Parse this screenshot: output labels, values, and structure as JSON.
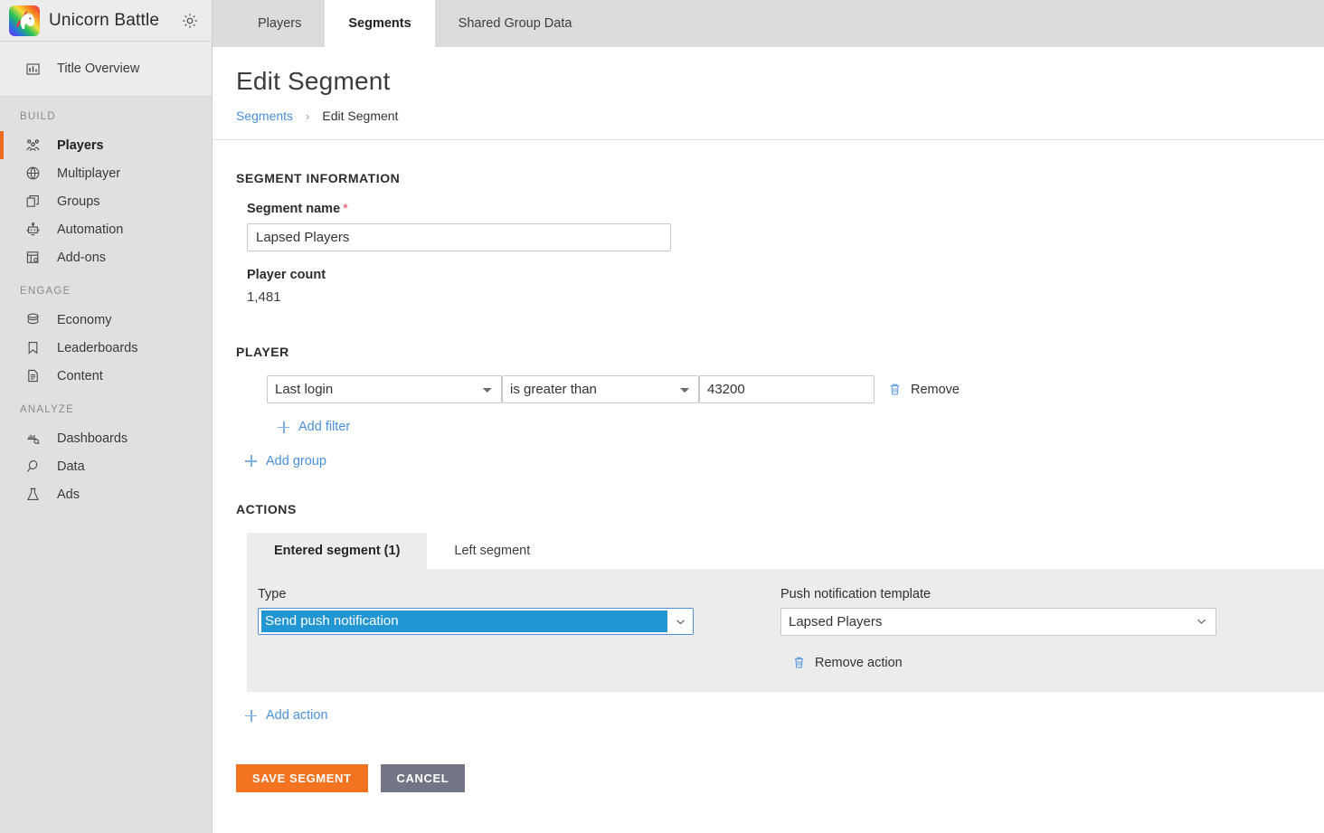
{
  "sidebar": {
    "brand": {
      "title": "Unicorn Battle",
      "logo_icon": "unicorn-logo",
      "settings_icon": "gear-icon"
    },
    "overview": {
      "label": "Title Overview",
      "icon": "bar-chart-icon"
    },
    "groups": [
      {
        "heading": "BUILD",
        "items": [
          {
            "label": "Players",
            "icon": "players-icon",
            "active": true
          },
          {
            "label": "Multiplayer",
            "icon": "globe-icon",
            "active": false
          },
          {
            "label": "Groups",
            "icon": "layers-icon",
            "active": false
          },
          {
            "label": "Automation",
            "icon": "robot-icon",
            "active": false
          },
          {
            "label": "Add-ons",
            "icon": "addons-icon",
            "active": false
          }
        ]
      },
      {
        "heading": "ENGAGE",
        "items": [
          {
            "label": "Economy",
            "icon": "coins-icon",
            "active": false
          },
          {
            "label": "Leaderboards",
            "icon": "bookmark-icon",
            "active": false
          },
          {
            "label": "Content",
            "icon": "document-icon",
            "active": false
          }
        ]
      },
      {
        "heading": "ANALYZE",
        "items": [
          {
            "label": "Dashboards",
            "icon": "dashboard-icon",
            "active": false
          },
          {
            "label": "Data",
            "icon": "data-icon",
            "active": false
          },
          {
            "label": "Ads",
            "icon": "flask-icon",
            "active": false
          }
        ]
      }
    ]
  },
  "tabs": [
    {
      "label": "Players",
      "active": false
    },
    {
      "label": "Segments",
      "active": true
    },
    {
      "label": "Shared Group Data",
      "active": false
    }
  ],
  "page": {
    "title": "Edit Segment",
    "breadcrumb": {
      "link": "Segments",
      "separator": "›",
      "current": "Edit Segment"
    }
  },
  "segment_information": {
    "heading": "SEGMENT INFORMATION",
    "name_label": "Segment name",
    "required_marker": "*",
    "name_value": "Lapsed Players",
    "name_placeholder": "",
    "player_count_label": "Player count",
    "player_count_value": "1,481"
  },
  "player_section": {
    "heading": "PLAYER",
    "filters": [
      {
        "property": "Last login",
        "operator": "is greater than",
        "value": "43200",
        "remove_label": "Remove",
        "remove_icon": "trash-icon"
      }
    ],
    "add_filter_label": "Add filter",
    "add_group_label": "Add group"
  },
  "actions_section": {
    "heading": "ACTIONS",
    "tabs": [
      {
        "label": "Entered segment (1)",
        "active": true
      },
      {
        "label": "Left segment",
        "active": false
      }
    ],
    "type_label": "Type",
    "type_value": "Send push notification",
    "template_label": "Push notification template",
    "template_value": "Lapsed Players",
    "remove_action_label": "Remove action",
    "remove_action_icon": "trash-icon",
    "add_action_label": "Add action"
  },
  "footer": {
    "save_label": "SAVE SEGMENT",
    "cancel_label": "CANCEL"
  },
  "colors": {
    "accent_orange": "#f47321",
    "active_indicator": "#ee6a1e",
    "link_blue": "#4a90d9",
    "select_highlight": "#2196d3",
    "cancel_gray": "#717585",
    "required_red": "#e8435a",
    "sidebar_bg": "#e0e0e0",
    "panel_bg": "#ececec"
  }
}
